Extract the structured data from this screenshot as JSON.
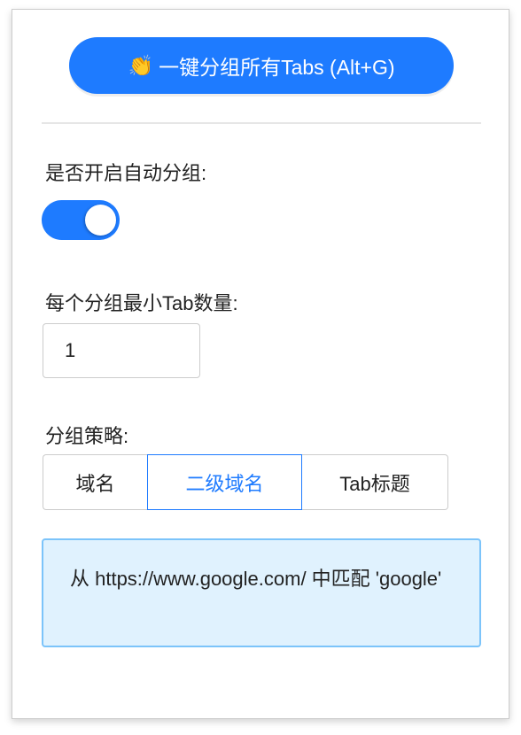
{
  "group_button": {
    "emoji": "👏",
    "label": "一键分组所有Tabs (Alt+G)"
  },
  "auto_group": {
    "label": "是否开启自动分组:",
    "enabled": true
  },
  "min_tabs": {
    "label": "每个分组最小Tab数量:",
    "value": "1"
  },
  "strategy": {
    "label": "分组策略:",
    "options": [
      "域名",
      "二级域名",
      "Tab标题"
    ],
    "selected": "二级域名"
  },
  "info": {
    "text": "从 https://www.google.com/ 中匹配 'google'"
  },
  "colors": {
    "accent": "#1e7bff",
    "info_bg": "#e0f2fe",
    "info_border": "#7cc4fa"
  }
}
